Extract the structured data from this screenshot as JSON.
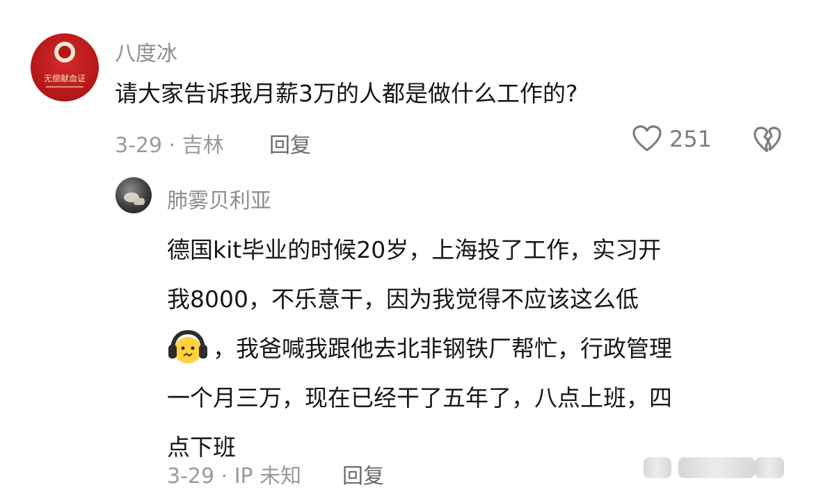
{
  "top_comment": {
    "username": "八度冰",
    "text": "请大家告诉我月薪3万的人都是做什么工作的?",
    "date_location": "3-29 · 吉林",
    "reply_label": "回复",
    "like_count": "251",
    "avatar_text": "无偿献血证"
  },
  "reply": {
    "username": "肺雾贝利亚",
    "lines": [
      "德国kit毕业的时候20岁，上海投了工作，实习开",
      "我8000，不乐意干，因为我觉得不应该这么低",
      "，我爸喊我跟他去北非钢铁厂帮忙，行政管理",
      "一个月三万，现在已经干了五年了，八点上班，四",
      "点下班"
    ],
    "date_location": "3-29 · IP 未知",
    "reply_label": "回复"
  },
  "colors": {
    "username": "#8d8d8d",
    "meta": "#9a9a9a",
    "text": "#161616",
    "avatar_red": "#b31717"
  },
  "icons": {
    "like": "heart-outline-icon",
    "dislike": "broken-heart-icon",
    "emoji": "headphones-face-emoji"
  }
}
